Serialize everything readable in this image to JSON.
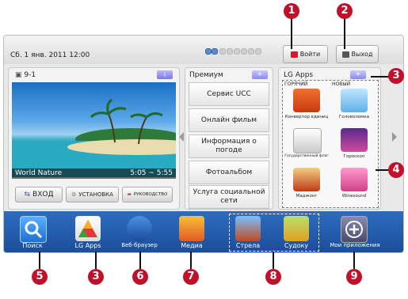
{
  "topbar": {
    "date": "Сб. 1 янв. 2011 12:00",
    "login_label": "Войти",
    "logout_label": "Выход",
    "page_dots": 8,
    "active_dots": 2
  },
  "tv": {
    "channel": "9-1",
    "info_label": "i",
    "program": "World Nature",
    "time": "5:05 ~ 5:55",
    "buttons": [
      "ВХОД",
      "УСТАНОВКА",
      "РУКОВОДСТВО"
    ]
  },
  "premium": {
    "title": "Премиум",
    "add_label": "+",
    "items": [
      "Сервис UCC",
      "Онлайн фильм",
      "Информация о погоде",
      "Фотоальбом",
      "Услуга социальной сети"
    ]
  },
  "lgapps": {
    "title": "LG Apps",
    "add_label": "+",
    "tags": [
      "ГОРЯЧИЙ",
      "НОВЫЙ"
    ],
    "apps": [
      {
        "name": "Конвертор единиц",
        "icon": "unit-converter-icon"
      },
      {
        "name": "Головоломка",
        "icon": "puzzle-icon"
      },
      {
        "name": "Государственный флаг",
        "icon": "flags-icon"
      },
      {
        "name": "Гороскоп",
        "icon": "horoscope-icon"
      },
      {
        "name": "Маджонг",
        "icon": "mahjong-icon"
      },
      {
        "name": "Winesound",
        "icon": "winesound-icon"
      }
    ]
  },
  "dock": {
    "items": [
      {
        "label": "Поиск",
        "icon": "search-icon"
      },
      {
        "label": "LG Apps",
        "icon": "lg-apps-icon"
      },
      {
        "label": "Веб-браузер",
        "icon": "globe-icon"
      },
      {
        "label": "Медиа",
        "icon": "media-cube-icon"
      },
      {
        "label": "Стрела",
        "icon": "arrow-game-icon"
      },
      {
        "label": "Судоку",
        "icon": "sudoku-icon"
      },
      {
        "label": "Мои приложения",
        "icon": "plus-icon"
      }
    ]
  },
  "callouts": [
    "1",
    "2",
    "3",
    "4",
    "5",
    "3",
    "6",
    "7",
    "8",
    "9"
  ],
  "colors": {
    "callout": "#c0102a",
    "dock": "#2d6cc0",
    "accent_button": "#8a8ae8"
  }
}
